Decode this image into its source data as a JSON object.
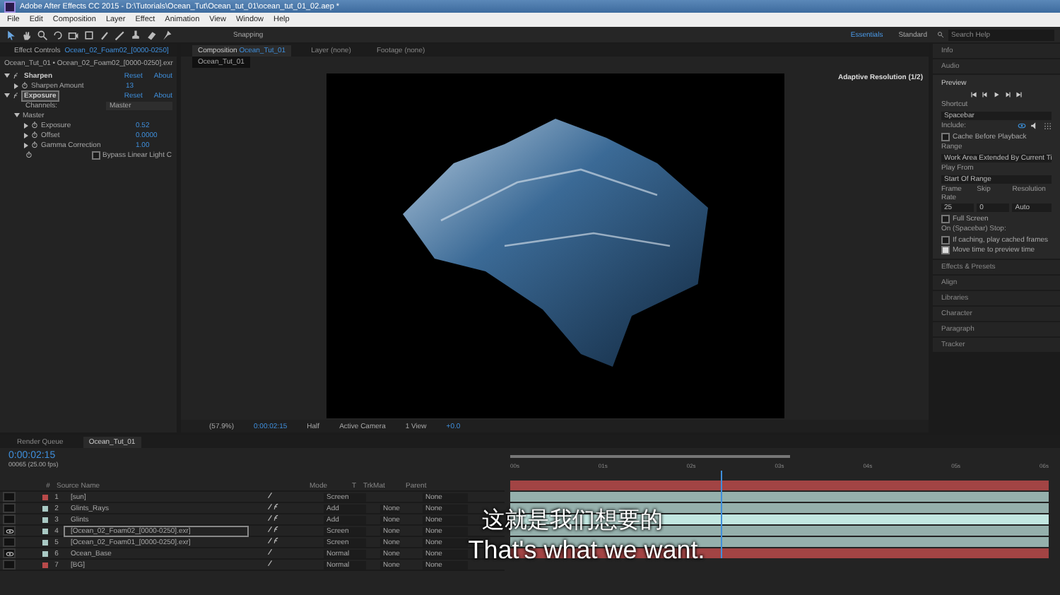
{
  "window": {
    "title": "Adobe After Effects CC 2015 - D:\\Tutorials\\Ocean_Tut\\Ocean_tut_01\\ocean_tut_01_02.aep *"
  },
  "menu": [
    "File",
    "Edit",
    "Composition",
    "Layer",
    "Effect",
    "Animation",
    "View",
    "Window",
    "Help"
  ],
  "toolbar": {
    "snapping": "Snapping",
    "workspaces": [
      {
        "label": "Essentials",
        "selected": true
      },
      {
        "label": "Standard",
        "selected": false
      }
    ],
    "search": {
      "placeholder": "Search Help"
    }
  },
  "effect_controls": {
    "tab": "Effect Controls",
    "tab_layer": "Ocean_02_Foam02_[0000-0250]",
    "breadcrumb": "Ocean_Tut_01 • Ocean_02_Foam02_[0000-0250].exr",
    "effects": [
      {
        "kind": "effect",
        "name": "Sharpen",
        "reset": "Reset",
        "about": "About",
        "expanded": true,
        "selected": false,
        "children": [
          {
            "kind": "param",
            "name": "Sharpen Amount",
            "value": "13",
            "expanded": false
          }
        ]
      },
      {
        "kind": "effect",
        "name": "Exposure",
        "reset": "Reset",
        "about": "About",
        "expanded": true,
        "selected": true,
        "children": [
          {
            "kind": "dropdown",
            "name": "Channels:",
            "value": "Master"
          },
          {
            "kind": "group",
            "name": "Master",
            "expanded": true,
            "children": [
              {
                "kind": "param",
                "name": "Exposure",
                "value": "0.52",
                "expanded": false
              },
              {
                "kind": "param",
                "name": "Offset",
                "value": "0.0000",
                "expanded": false
              },
              {
                "kind": "param",
                "name": "Gamma Correction",
                "value": "1.00",
                "expanded": false
              }
            ]
          },
          {
            "kind": "checkbox",
            "name": "Bypass Linear Light C",
            "checked": false
          }
        ]
      }
    ]
  },
  "viewer": {
    "tabs": [
      {
        "label": "Composition",
        "name": "Ocean_Tut_01",
        "selected": true
      },
      {
        "label": "Layer (none)",
        "selected": false
      },
      {
        "label": "Footage (none)",
        "selected": false
      }
    ],
    "comp_tab": "Ocean_Tut_01",
    "adaptive": "Adaptive Resolution (1/2)",
    "bottom": {
      "zoom": "(57.9%)",
      "time": "0:00:02:15",
      "resolution": "Half",
      "camera": "Active Camera",
      "views": "1 View",
      "exposure": "+0.0"
    }
  },
  "panels_top": [
    "Info",
    "Audio"
  ],
  "preview": {
    "title": "Preview",
    "shortcut_label": "Shortcut",
    "shortcut": "Spacebar",
    "include_label": "Include:",
    "cache": {
      "label": "Cache Before Playback",
      "checked": false
    },
    "range_label": "Range",
    "range": "Work Area Extended By Current Ti",
    "play_from_label": "Play From",
    "play_from": "Start Of Range",
    "frame_rate_label": "Frame Rate",
    "skip_label": "Skip",
    "resolution_label": "Resolution",
    "frame_rate": "25",
    "skip": "0",
    "resolution": "Auto",
    "full_screen": {
      "label": "Full Screen",
      "checked": false
    },
    "stop_label": "On (Spacebar) Stop:",
    "stop_options": [
      {
        "label": "If caching, play cached frames",
        "checked": false
      },
      {
        "label": "Move time to preview time",
        "checked": true
      }
    ]
  },
  "panels_bottom": [
    "Effects & Presets",
    "Align",
    "Libraries",
    "Character",
    "Paragraph",
    "Tracker"
  ],
  "timeline": {
    "tabs": [
      {
        "label": "Render Queue",
        "selected": false
      },
      {
        "label": "Ocean_Tut_01",
        "selected": true
      }
    ],
    "timecode": "0:00:02:15",
    "frames": "00065 (25.00 fps)",
    "columns": {
      "number": "#",
      "source": "Source Name",
      "mode": "Mode",
      "t": "T",
      "trkmat": "TrkMat",
      "parent": "Parent"
    },
    "ruler": [
      "00s",
      "01s",
      "02s",
      "03s",
      "04s",
      "05s",
      "06s"
    ],
    "playhead": {
      "level": 0.39
    },
    "layers": [
      {
        "number": "1",
        "name": "[sun]",
        "color": "#b84a4a",
        "visible": false,
        "selected": false,
        "fx": false,
        "mode": "Screen",
        "parent": "None"
      },
      {
        "number": "2",
        "name": "Glints_Rays",
        "color": "#a9c9c4",
        "visible": false,
        "selected": false,
        "fx": true,
        "mode": "Add",
        "trkmat": "None",
        "parent": "None"
      },
      {
        "number": "3",
        "name": "Glints",
        "color": "#a9c9c4",
        "visible": false,
        "selected": false,
        "fx": true,
        "mode": "Add",
        "trkmat": "None",
        "parent": "None"
      },
      {
        "number": "4",
        "name": "[Ocean_02_Foam02_[0000-0250].exr]",
        "color": "#a9c9c4",
        "visible": true,
        "selected": true,
        "fx": true,
        "mode": "Screen",
        "trkmat": "None",
        "parent": "None"
      },
      {
        "number": "5",
        "name": "[Ocean_02_Foam01_[0000-0250].exr]",
        "color": "#a9c9c4",
        "visible": false,
        "selected": false,
        "fx": true,
        "mode": "Screen",
        "trkmat": "None",
        "parent": "None"
      },
      {
        "number": "6",
        "name": "Ocean_Base",
        "color": "#a9c9c4",
        "visible": true,
        "selected": false,
        "fx": false,
        "mode": "Normal",
        "trkmat": "None",
        "parent": "None"
      },
      {
        "number": "7",
        "name": "[BG]",
        "color": "#b84a4a",
        "visible": false,
        "selected": false,
        "fx": false,
        "mode": "Normal",
        "trkmat": "None",
        "parent": "None"
      }
    ]
  },
  "subtitles": {
    "chinese": "这就是我们想要的",
    "english": "That's what we want."
  }
}
